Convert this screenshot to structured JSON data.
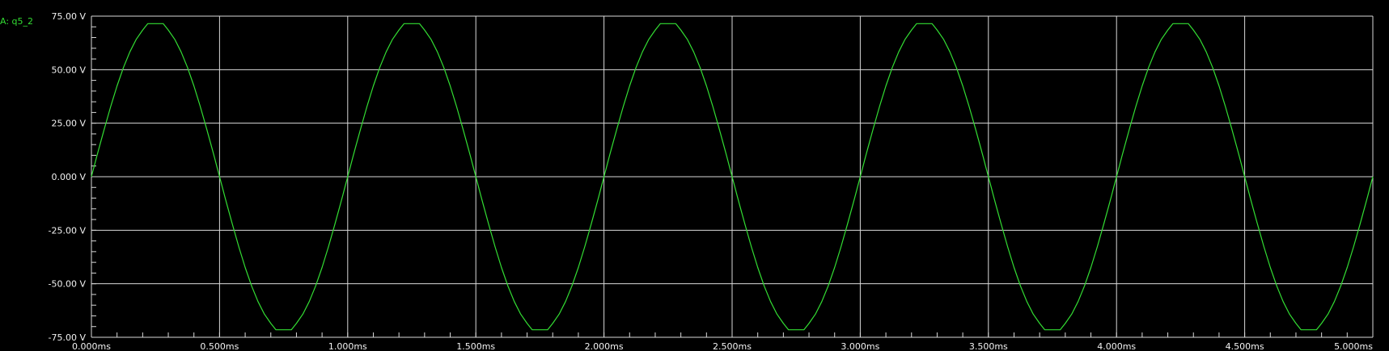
{
  "legend": {
    "label": "A: q5_2"
  },
  "colors": {
    "background": "#000000",
    "grid": "#d9d9d9",
    "trace": "#33dd33",
    "text": "#f2f2f2"
  },
  "chart_data": {
    "type": "line",
    "xlim": [
      0,
      5.0
    ],
    "ylim": [
      -75,
      75
    ],
    "x_ticks": [
      0,
      0.5,
      1.0,
      1.5,
      2.0,
      2.5,
      3.0,
      3.5,
      4.0,
      4.5,
      5.0
    ],
    "x_tick_labels": [
      "0.000ms",
      "0.500ms",
      "1.000ms",
      "1.500ms",
      "2.000ms",
      "2.500ms",
      "3.000ms",
      "3.500ms",
      "4.000ms",
      "4.500ms",
      "5.000ms"
    ],
    "y_ticks": [
      75,
      50,
      25,
      0,
      -25,
      -50,
      -75
    ],
    "y_tick_labels": [
      "75.00 V",
      "50.00 V",
      "25.00 V",
      "0.000 V",
      "-25.00 V",
      "-50.00 V",
      "-75.00 V"
    ],
    "grid": true,
    "series": [
      {
        "name": "q5_2",
        "color": "#33dd33",
        "x": [
          0.0,
          0.005,
          0.01,
          0.02,
          0.03,
          0.05,
          0.075,
          0.1,
          0.125,
          0.15,
          0.175,
          0.2,
          0.22,
          0.28,
          0.3,
          0.325,
          0.35,
          0.375,
          0.4,
          0.425,
          0.45,
          0.47,
          0.48,
          0.49,
          0.5,
          0.51,
          0.52,
          0.53,
          0.55,
          0.575,
          0.6,
          0.625,
          0.65,
          0.675,
          0.7,
          0.72,
          0.78,
          0.8,
          0.825,
          0.85,
          0.875,
          0.9,
          0.925,
          0.95,
          0.97,
          0.98,
          0.99,
          1.0,
          1.01,
          1.02,
          1.03,
          1.05,
          1.075,
          1.1,
          1.125,
          1.15,
          1.175,
          1.2,
          1.22,
          1.28,
          1.3,
          1.325,
          1.35,
          1.375,
          1.4,
          1.425,
          1.45,
          1.47,
          1.48,
          1.49,
          1.5,
          1.51,
          1.52,
          1.53,
          1.55,
          1.575,
          1.6,
          1.625,
          1.65,
          1.675,
          1.7,
          1.72,
          1.78,
          1.8,
          1.825,
          1.85,
          1.875,
          1.9,
          1.925,
          1.95,
          1.97,
          1.98,
          1.99,
          2.0,
          2.01,
          2.02,
          2.03,
          2.05,
          2.075,
          2.1,
          2.125,
          2.15,
          2.175,
          2.2,
          2.22,
          2.28,
          2.3,
          2.325,
          2.35,
          2.375,
          2.4,
          2.425,
          2.45,
          2.47,
          2.48,
          2.49,
          2.5,
          2.51,
          2.52,
          2.53,
          2.55,
          2.575,
          2.6,
          2.625,
          2.65,
          2.675,
          2.7,
          2.72,
          2.78,
          2.8,
          2.825,
          2.85,
          2.875,
          2.9,
          2.925,
          2.95,
          2.97,
          2.98,
          2.99,
          3.0,
          3.01,
          3.02,
          3.03,
          3.05,
          3.075,
          3.1,
          3.125,
          3.15,
          3.175,
          3.2,
          3.22,
          3.28,
          3.3,
          3.325,
          3.35,
          3.375,
          3.4,
          3.425,
          3.45,
          3.47,
          3.48,
          3.49,
          3.5,
          3.51,
          3.52,
          3.53,
          3.55,
          3.575,
          3.6,
          3.625,
          3.65,
          3.675,
          3.7,
          3.72,
          3.78,
          3.8,
          3.825,
          3.85,
          3.875,
          3.9,
          3.925,
          3.95,
          3.97,
          3.98,
          3.99,
          4.0,
          4.01,
          4.02,
          4.03,
          4.05,
          4.075,
          4.1,
          4.125,
          4.15,
          4.175,
          4.2,
          4.22,
          4.28,
          4.3,
          4.325,
          4.35,
          4.375,
          4.4,
          4.425,
          4.45,
          4.47,
          4.48,
          4.49,
          4.5,
          4.51,
          4.52,
          4.53,
          4.55,
          4.575,
          4.6,
          4.625,
          4.65,
          4.675,
          4.7,
          4.72,
          4.78,
          4.8,
          4.825,
          4.85,
          4.875,
          4.9,
          4.925,
          4.95,
          4.97,
          4.98,
          4.99,
          5.0
        ],
        "y": [
          0.0,
          2.3,
          4.5,
          9.1,
          13.5,
          22.2,
          32.7,
          42.4,
          51.0,
          58.3,
          64.2,
          68.5,
          71.5,
          71.5,
          68.5,
          64.2,
          58.3,
          51.0,
          42.4,
          32.7,
          22.2,
          13.5,
          9.1,
          4.5,
          0.0,
          -4.5,
          -9.1,
          -13.5,
          -22.2,
          -32.7,
          -42.4,
          -51.0,
          -58.3,
          -64.2,
          -68.5,
          -71.5,
          -71.5,
          -68.5,
          -64.2,
          -58.3,
          -51.0,
          -42.4,
          -32.7,
          -22.2,
          -13.5,
          -9.1,
          -4.5,
          0.0,
          4.5,
          9.1,
          13.5,
          22.2,
          32.7,
          42.4,
          51.0,
          58.3,
          64.2,
          68.5,
          71.5,
          71.5,
          68.5,
          64.2,
          58.3,
          51.0,
          42.4,
          32.7,
          22.2,
          13.5,
          9.1,
          4.5,
          0.0,
          -4.5,
          -9.1,
          -13.5,
          -22.2,
          -32.7,
          -42.4,
          -51.0,
          -58.3,
          -64.2,
          -68.5,
          -71.5,
          -71.5,
          -68.5,
          -64.2,
          -58.3,
          -51.0,
          -42.4,
          -32.7,
          -22.2,
          -13.5,
          -9.1,
          -4.5,
          0.0,
          4.5,
          9.1,
          13.5,
          22.2,
          32.7,
          42.4,
          51.0,
          58.3,
          64.2,
          68.5,
          71.5,
          71.5,
          68.5,
          64.2,
          58.3,
          51.0,
          42.4,
          32.7,
          22.2,
          13.5,
          9.1,
          4.5,
          0.0,
          -4.5,
          -9.1,
          -13.5,
          -22.2,
          -32.7,
          -42.4,
          -51.0,
          -58.3,
          -64.2,
          -68.5,
          -71.5,
          -71.5,
          -68.5,
          -64.2,
          -58.3,
          -51.0,
          -42.4,
          -32.7,
          -22.2,
          -13.5,
          -9.1,
          -4.5,
          0.0,
          4.5,
          9.1,
          13.5,
          22.2,
          32.7,
          42.4,
          51.0,
          58.3,
          64.2,
          68.5,
          71.5,
          71.5,
          68.5,
          64.2,
          58.3,
          51.0,
          42.4,
          32.7,
          22.2,
          13.5,
          9.1,
          4.5,
          0.0,
          -4.5,
          -9.1,
          -13.5,
          -22.2,
          -32.7,
          -42.4,
          -51.0,
          -58.3,
          -64.2,
          -68.5,
          -71.5,
          -71.5,
          -68.5,
          -64.2,
          -58.3,
          -51.0,
          -42.4,
          -32.7,
          -22.2,
          -13.5,
          -9.1,
          -4.5,
          0.0,
          4.5,
          9.1,
          13.5,
          22.2,
          32.7,
          42.4,
          51.0,
          58.3,
          64.2,
          68.5,
          71.5,
          71.5,
          68.5,
          64.2,
          58.3,
          51.0,
          42.4,
          32.7,
          22.2,
          13.5,
          9.1,
          4.5,
          0.0,
          -4.5,
          -9.1,
          -13.5,
          -22.2,
          -32.7,
          -42.4,
          -51.0,
          -58.3,
          -64.2,
          -68.5,
          -71.5,
          -71.5,
          -68.5,
          -64.2,
          -58.3,
          -51.0,
          -42.4,
          -32.7,
          -22.2,
          -13.5,
          -9.1,
          -4.5,
          0.0
        ]
      }
    ]
  }
}
